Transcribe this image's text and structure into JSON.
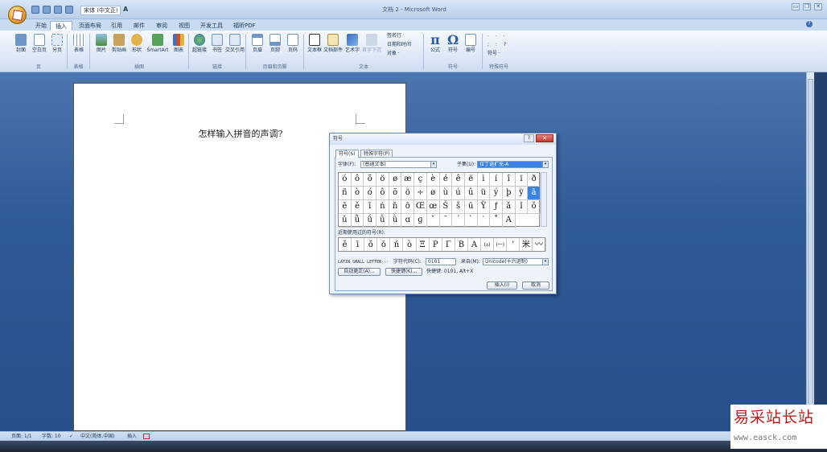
{
  "window": {
    "title": "文档 2 - Microsoft Word",
    "font_name": "宋体 (中文正)",
    "min_label": "▭",
    "restore_label": "❐",
    "close_label": "✕"
  },
  "tabs": [
    "开始",
    "插入",
    "页面布局",
    "引用",
    "邮件",
    "审阅",
    "视图",
    "开发工具",
    "福昕PDF"
  ],
  "active_tab": "插入",
  "ribbon": {
    "buttons": [
      "封面",
      "空白页",
      "分页",
      "表格",
      "图片",
      "剪贴画",
      "形状",
      "SmartArt",
      "图表",
      "超链接",
      "书签",
      "交叉引用",
      "页眉",
      "页脚",
      "页码",
      "文本框",
      "文档部件",
      "艺术字",
      "首字下沉",
      "公式",
      "符号",
      "编号"
    ],
    "text_small": [
      "签名行 ·",
      "日期和时间",
      "对象 ·"
    ],
    "special_small": "符号 ·",
    "groups": [
      "页",
      "表格",
      "插图",
      "链接",
      "页眉和页脚",
      "文本",
      "符号",
      "特殊符号"
    ]
  },
  "document": {
    "heading": "怎样输入拼音的声调?"
  },
  "dialog": {
    "title": "符号",
    "help": "?",
    "close": "✕",
    "tabs": [
      "符号(S)",
      "特殊字符(P)"
    ],
    "font_label": "字体(F):",
    "font_value": "(普通文本)",
    "subset_label": "子集(U):",
    "subset_value": "拉丁语扩充-A",
    "symbols": [
      "ó",
      "ô",
      "õ",
      "ö",
      "ø",
      "æ",
      "ç",
      "è",
      "é",
      "ê",
      "ë",
      "ì",
      "í",
      "î",
      "ï",
      "ð",
      "ñ",
      "ò",
      "ó",
      "ô",
      "õ",
      "ö",
      "÷",
      "ø",
      "ù",
      "ú",
      "û",
      "ü",
      "ý",
      "þ",
      "ÿ",
      "ā",
      "ē",
      "ě",
      "ī",
      "ń",
      "ň",
      "ō",
      "Œ",
      "œ",
      "Š",
      "š",
      "ū",
      "Ÿ",
      "ƒ",
      "ǎ",
      "ǐ",
      "ǒ",
      "ǔ",
      "ǖ",
      "ǘ",
      "ǚ",
      "ǜ",
      "ɑ",
      "ɡ",
      "ˇ",
      "ˉ",
      "ˊ",
      "ˋ",
      "˙",
      "˚",
      "Α"
    ],
    "selected_index": 31,
    "recent_label": "近期使用过的符号(R):",
    "recent": [
      "ě",
      "ī",
      "ǒ",
      "ō",
      "ń",
      "ò",
      "Ξ",
      "Ρ",
      "Γ",
      "Β",
      "Α",
      "(ʌ)",
      "(一)",
      "’",
      "米",
      "〰"
    ],
    "char_name": "LATIN SMALL LETTER···",
    "code_label": "字符代码(C):",
    "code_value": "0101",
    "from_label": "来自(M):",
    "from_value": "Unicode(十六进制)",
    "autocorrect": "自动更正(A)...",
    "shortcut_key": "快捷键(K)...",
    "shortcut_text": "快捷键: 0101, Alt+X",
    "insert": "插入(I)",
    "cancel": "取消"
  },
  "status": {
    "page": "页面: 1/1",
    "words": "字数: 10",
    "lang": "中文(简体,中国)",
    "mode": "插入"
  },
  "watermark": {
    "logo": "易采站长站",
    "url": "www.easck.com"
  },
  "colors": {
    "workspace": "#2f5b97",
    "ribbon": "#dbe7f6",
    "selection": "#3c83df",
    "close_button": "#c6362a",
    "watermark_red": "#c11a1a"
  }
}
